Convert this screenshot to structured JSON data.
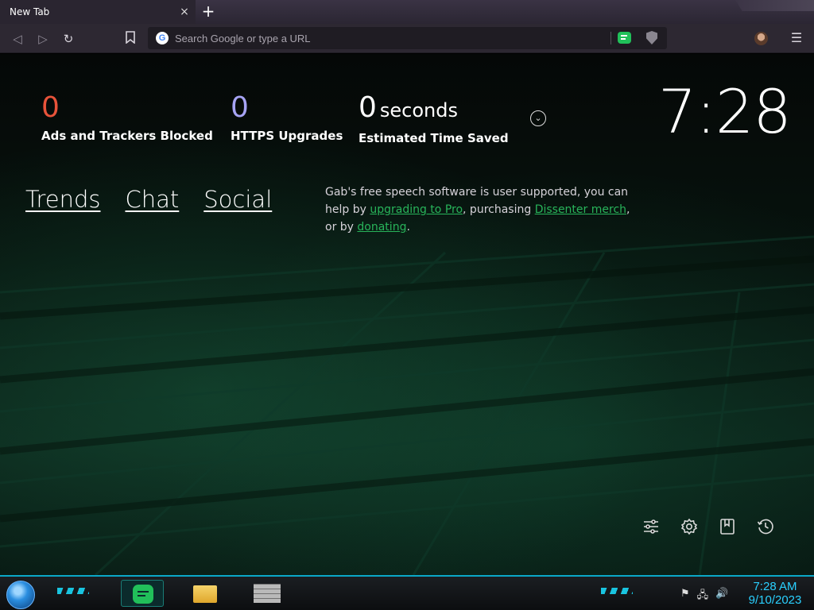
{
  "tab": {
    "title": "New Tab",
    "close": "×",
    "new_tab": "+"
  },
  "toolbar": {
    "back": "◁",
    "forward": "▷",
    "reload": "↻",
    "bookmark": "🔖",
    "omnibox_placeholder": "Search Google or type a URL",
    "google_letter": "G",
    "menu": "☰"
  },
  "stats": {
    "ads": {
      "value": "0",
      "label": "Ads and Trackers Blocked",
      "color": "#e8533a"
    },
    "https": {
      "value": "0",
      "label": "HTTPS Upgrades",
      "color": "#a7a4f4"
    },
    "time": {
      "value": "0",
      "unit": "seconds",
      "label": "Estimated Time Saved",
      "color": "#ffffff"
    }
  },
  "clock": "7:28",
  "links": [
    {
      "label": "Trends"
    },
    {
      "label": "Chat"
    },
    {
      "label": "Social"
    }
  ],
  "gab_message": {
    "part1": "Gab's free speech software is user supported, you can help by ",
    "link1": "upgrading to Pro",
    "part2": ", purchasing ",
    "link2": "Dissenter merch",
    "part3": ", or by ",
    "link3": "donating",
    "part4": "."
  },
  "bottom_icons": [
    "customize-icon",
    "settings-icon",
    "bookmarks-icon",
    "history-icon"
  ],
  "taskbar": {
    "time": "7:28 AM",
    "date": "9/10/2023",
    "accent_color": "#0aa8c8"
  }
}
